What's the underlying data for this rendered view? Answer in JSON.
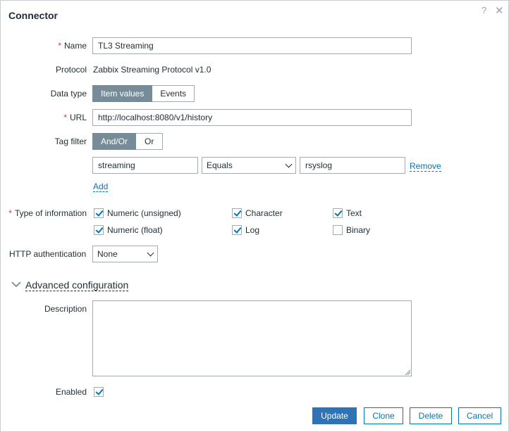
{
  "dialog": {
    "title": "Connector",
    "help_icon": "help-icon",
    "close_icon": "close-icon"
  },
  "form": {
    "name": {
      "label": "Name",
      "value": "TL3 Streaming",
      "required": true
    },
    "protocol": {
      "label": "Protocol",
      "value": "Zabbix Streaming Protocol v1.0"
    },
    "data_type": {
      "label": "Data type",
      "options": [
        "Item values",
        "Events"
      ],
      "selected": "Item values"
    },
    "url": {
      "label": "URL",
      "value": "http://localhost:8080/v1/history",
      "required": true
    },
    "tag_filter": {
      "label": "Tag filter",
      "options": [
        "And/Or",
        "Or"
      ],
      "selected": "And/Or",
      "rows": [
        {
          "tag": "streaming",
          "operator": "Equals",
          "value": "rsyslog",
          "remove_label": "Remove"
        }
      ],
      "add_label": "Add"
    },
    "type_of_information": {
      "label": "Type of information",
      "required": true,
      "options": [
        {
          "label": "Numeric (unsigned)",
          "checked": true
        },
        {
          "label": "Character",
          "checked": true
        },
        {
          "label": "Text",
          "checked": true
        },
        {
          "label": "Numeric (float)",
          "checked": true
        },
        {
          "label": "Log",
          "checked": true
        },
        {
          "label": "Binary",
          "checked": false
        }
      ]
    },
    "http_auth": {
      "label": "HTTP authentication",
      "value": "None"
    },
    "advanced": {
      "label": "Advanced configuration",
      "expanded": true
    },
    "description": {
      "label": "Description",
      "value": ""
    },
    "enabled": {
      "label": "Enabled",
      "checked": true
    }
  },
  "buttons": {
    "update": "Update",
    "clone": "Clone",
    "delete": "Delete",
    "cancel": "Cancel"
  },
  "colors": {
    "primary": "#2f73b7",
    "link": "#0275b8",
    "segment_active": "#768d99",
    "required": "#d23a3a"
  }
}
